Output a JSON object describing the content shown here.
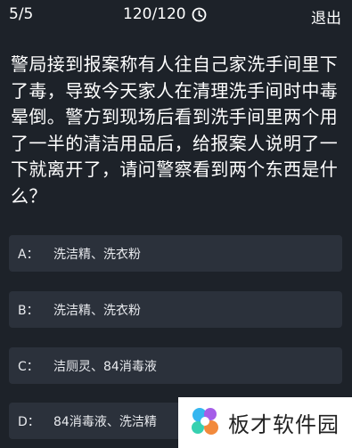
{
  "header": {
    "progress": "5/5",
    "timer": "120/120",
    "timer_icon": "clock-icon",
    "exit_label": "退出"
  },
  "question": {
    "text": "警局接到报案称有人往自己家洗手间里下了毒，导致今天家人在清理洗手间时中毒晕倒。警方到现场后看到洗手间里两个用了一半的清洁用品后，给报案人说明了一下就离开了，请问警察看到两个东西是什么？"
  },
  "options": [
    {
      "letter": "A：",
      "text": "洗洁精、洗衣粉"
    },
    {
      "letter": "B：",
      "text": "洗洁精、洗衣粉"
    },
    {
      "letter": "C：",
      "text": "洁厕灵、84消毒液"
    },
    {
      "letter": "D：",
      "text": "84消毒液、洗洁精"
    }
  ],
  "watermark": {
    "text": "板才软件园",
    "logo_icon": "bancai-logo-icon"
  },
  "colors": {
    "background": "#1d2229",
    "option_bg": "#2b313b",
    "text": "#ffffff"
  }
}
